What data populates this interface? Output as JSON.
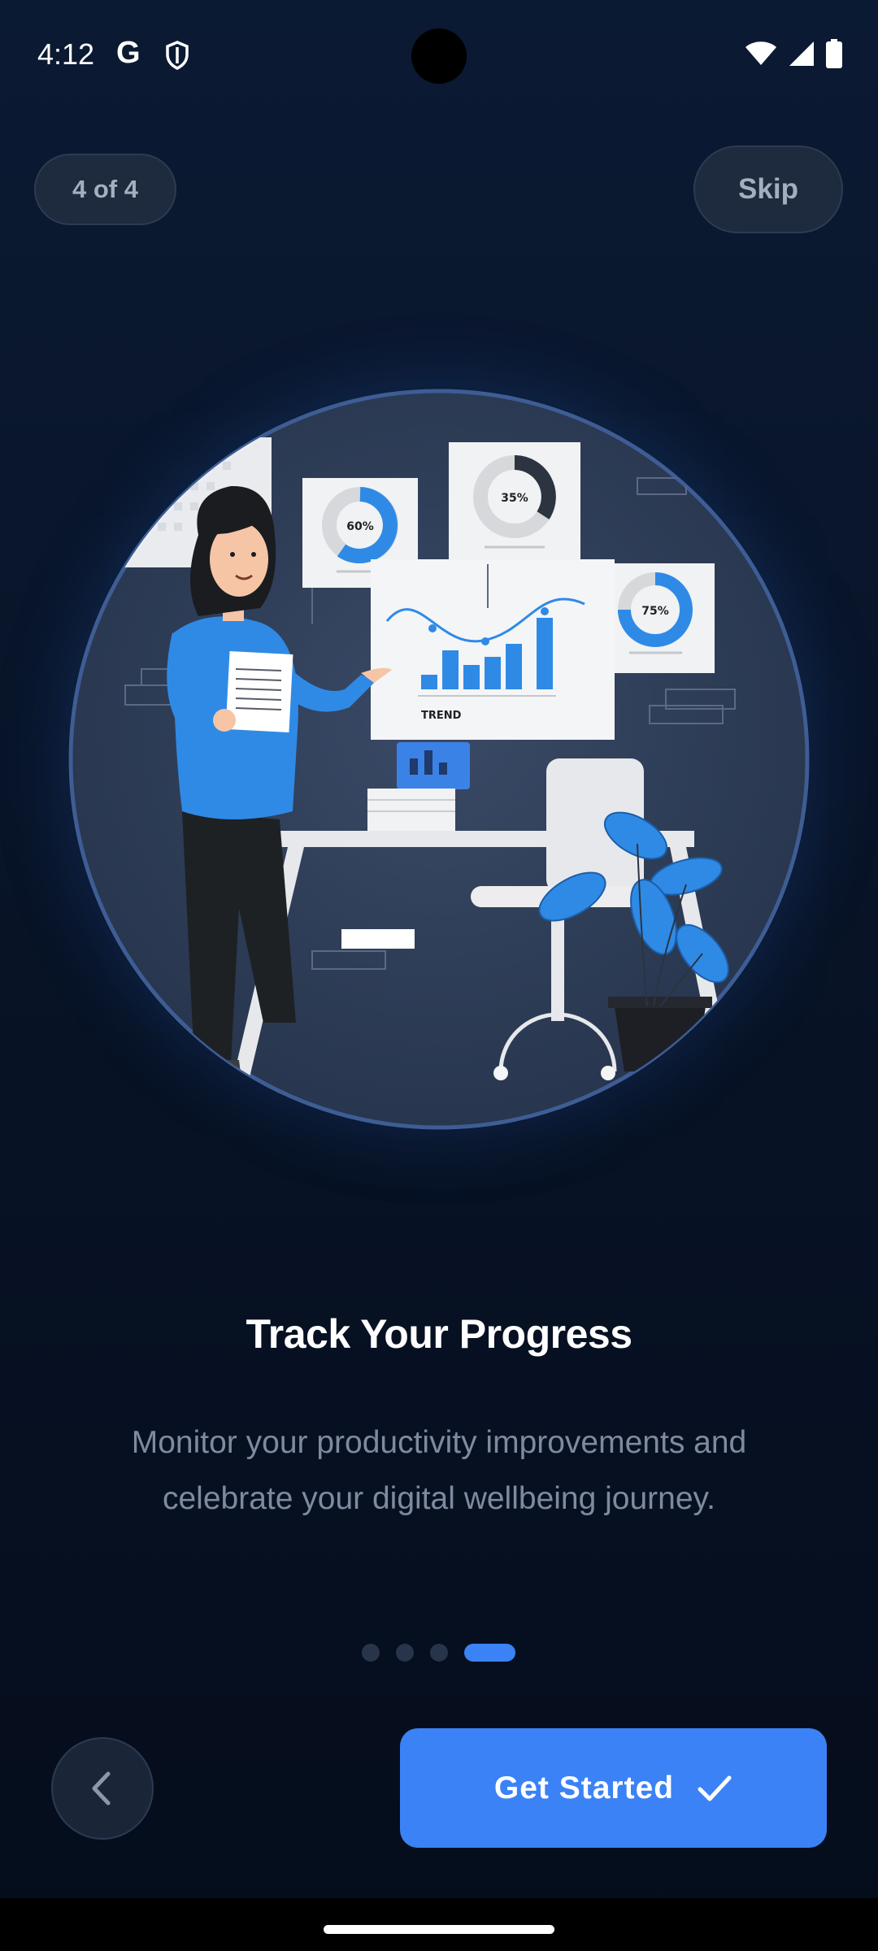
{
  "status_bar": {
    "time": "4:12",
    "google_glyph": "G",
    "icons": [
      "google-icon",
      "shield-icon",
      "wifi-icon",
      "signal-icon",
      "battery-icon"
    ]
  },
  "onboarding": {
    "step_indicator": "4 of 4",
    "skip_label": "Skip",
    "title": "Track Your Progress",
    "description": "Monitor your productivity improvements and celebrate your digital wellbeing journey.",
    "page_count": 4,
    "current_page": 4,
    "back_icon": "chevron-left-icon",
    "primary_label": "Get Started",
    "primary_icon": "check-icon"
  },
  "illustration": {
    "chart_labels": [
      "60%",
      "35%",
      "75%"
    ],
    "board_label": "TREND"
  },
  "colors": {
    "accent": "#3b82f6",
    "background": "#081428",
    "muted_text": "#7f8aa0",
    "pill_bg": "#1e2b3f"
  }
}
